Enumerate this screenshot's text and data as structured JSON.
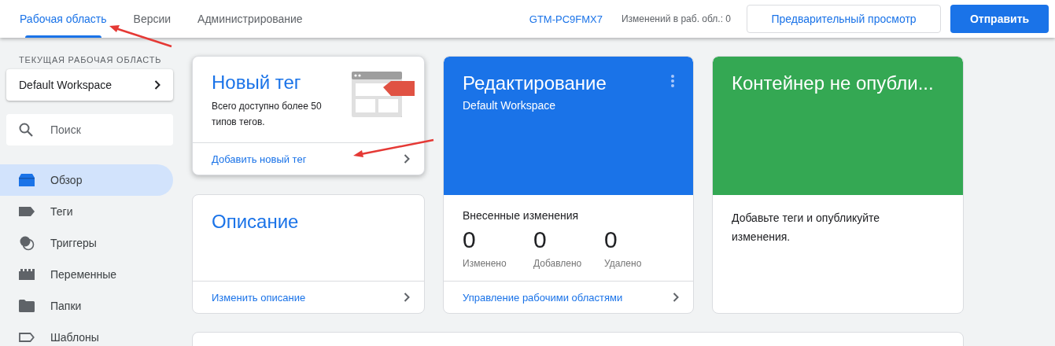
{
  "header": {
    "tabs": [
      {
        "label": "Рабочая область",
        "selected": true
      },
      {
        "label": "Версии",
        "selected": false
      },
      {
        "label": "Администрирование",
        "selected": false
      }
    ],
    "container_id": "GTM-PC9FMX7",
    "changes_label": "Изменений в раб. обл.: 0",
    "preview_button": "Предварительный просмотр",
    "submit_button": "Отправить"
  },
  "sidebar": {
    "section_label": "ТЕКУЩАЯ РАБОЧАЯ ОБЛАСТЬ",
    "workspace": "Default Workspace",
    "search": {
      "placeholder": "Поиск"
    },
    "items": [
      {
        "kind": "overview",
        "label": "Обзор",
        "selected": true
      },
      {
        "kind": "tag",
        "label": "Теги",
        "selected": false
      },
      {
        "kind": "trigger",
        "label": "Триггеры",
        "selected": false
      },
      {
        "kind": "variable",
        "label": "Переменные",
        "selected": false
      },
      {
        "kind": "folder",
        "label": "Папки",
        "selected": false
      },
      {
        "kind": "template",
        "label": "Шаблоны",
        "selected": false
      }
    ]
  },
  "new_tag_card": {
    "title": "Новый тег",
    "description": "Всего доступно более 50 типов тегов.",
    "link": "Добавить новый тег"
  },
  "description_card": {
    "title": "Описание",
    "link": "Изменить описание"
  },
  "workspace_card": {
    "title": "Редактирование",
    "subtitle": "Default Workspace",
    "changes_title": "Внесенные изменения",
    "stats": [
      {
        "value": "0",
        "label": "Изменено"
      },
      {
        "value": "0",
        "label": "Добавлено"
      },
      {
        "value": "0",
        "label": "Удалено"
      }
    ],
    "link": "Управление рабочими областями"
  },
  "status_card": {
    "title": "Контейнер не опубли...",
    "text": "Добавьте теги и опубликуйте изменения."
  }
}
